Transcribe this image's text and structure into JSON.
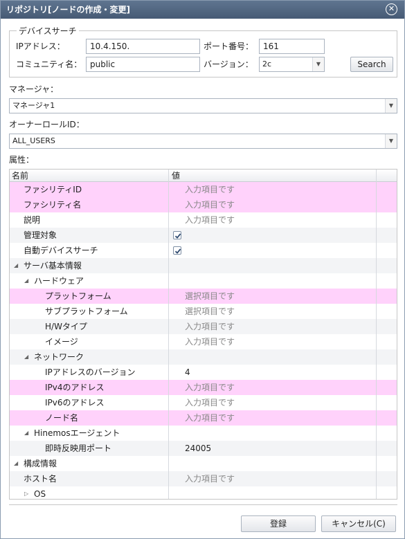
{
  "window": {
    "title": "リポジトリ[ノードの作成・変更]"
  },
  "device_search": {
    "legend": "デバイスサーチ",
    "ip_label": "IPアドレス：",
    "ip_value": "10.4.150.",
    "port_label": "ポート番号：",
    "port_value": "161",
    "community_label": "コミュニティ名：",
    "community_value": "public",
    "version_label": "バージョン：",
    "version_value": "2c",
    "search_label": "Search"
  },
  "manager": {
    "label": "マネージャ：",
    "value": "マネージャ1"
  },
  "owner_role": {
    "label": "オーナーロールID：",
    "value": "ALL_USERS"
  },
  "attributes": {
    "label": "属性：",
    "headers": {
      "name": "名前",
      "value": "値"
    },
    "rows": [
      {
        "name": "ファシリティID",
        "value": "入力項目です",
        "indent": 1,
        "required": true
      },
      {
        "name": "ファシリティ名",
        "value": "入力項目です",
        "indent": 1,
        "required": true
      },
      {
        "name": "説明",
        "value": "入力項目です",
        "indent": 1
      },
      {
        "name": "管理対象",
        "value": "",
        "indent": 1,
        "checkbox": true
      },
      {
        "name": "自動デバイスサーチ",
        "value": "",
        "indent": 1,
        "checkbox": true
      },
      {
        "name": "サーバ基本情報",
        "value": "",
        "indent": 0,
        "expander": "open"
      },
      {
        "name": "ハードウェア",
        "value": "",
        "indent": 1,
        "expander": "open"
      },
      {
        "name": "プラットフォーム",
        "value": "選択項目です",
        "indent": 2,
        "required": true
      },
      {
        "name": "サブプラットフォーム",
        "value": "選択項目です",
        "indent": 2
      },
      {
        "name": "H/Wタイプ",
        "value": "入力項目です",
        "indent": 2
      },
      {
        "name": "イメージ",
        "value": "入力項目です",
        "indent": 2
      },
      {
        "name": "ネットワーク",
        "value": "",
        "indent": 1,
        "expander": "open"
      },
      {
        "name": "IPアドレスのバージョン",
        "value": "4",
        "indent": 2,
        "dark": true
      },
      {
        "name": "IPv4のアドレス",
        "value": "入力項目です",
        "indent": 2,
        "required": true
      },
      {
        "name": "IPv6のアドレス",
        "value": "入力項目です",
        "indent": 2
      },
      {
        "name": "ノード名",
        "value": "入力項目です",
        "indent": 2,
        "required": true
      },
      {
        "name": "Hinemosエージェント",
        "value": "",
        "indent": 1,
        "expander": "open"
      },
      {
        "name": "即時反映用ポート",
        "value": "24005",
        "indent": 2,
        "dark": true
      },
      {
        "name": "構成情報",
        "value": "",
        "indent": 0,
        "expander": "open"
      },
      {
        "name": "ホスト名",
        "value": "入力項目です",
        "indent": 1
      },
      {
        "name": "OS",
        "value": "",
        "indent": 1,
        "expander": "closed"
      }
    ]
  },
  "footer": {
    "register_label": "登録",
    "cancel_label": "キャンセル(C)"
  },
  "colors": {
    "title_bar": "#4f6580",
    "required_row": "#ffd2fb",
    "placeholder_text": "#888888"
  }
}
